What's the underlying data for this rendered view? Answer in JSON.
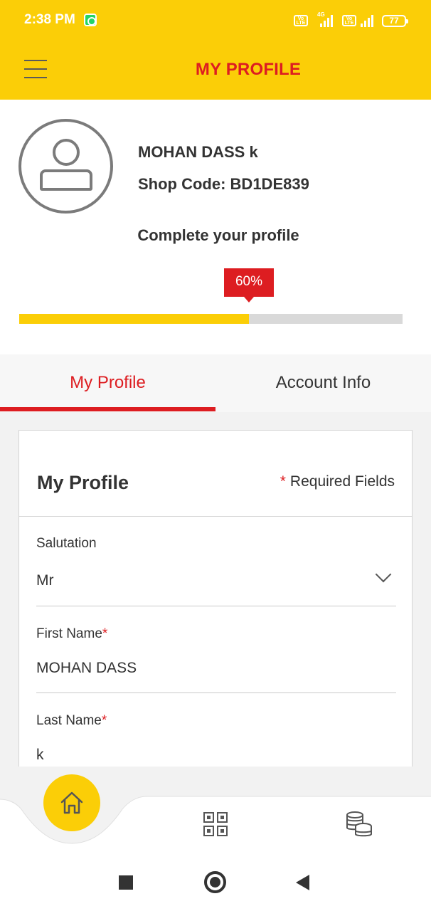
{
  "status_bar": {
    "time": "2:38 PM",
    "network": "4G",
    "battery": "77"
  },
  "header": {
    "title": "MY PROFILE"
  },
  "profile": {
    "name": "MOHAN DASS k",
    "shop_code": "Shop Code: BD1DE839",
    "complete_prompt": "Complete your profile",
    "progress_label": "60%",
    "progress_fraction": 0.6
  },
  "tabs": [
    {
      "label": "My Profile",
      "active": true
    },
    {
      "label": "Account Info",
      "active": false
    }
  ],
  "form": {
    "title": "My Profile",
    "required_star": "*",
    "required_note": "Required Fields",
    "fields": [
      {
        "label": "Salutation",
        "required": false,
        "value": "Mr",
        "type": "select"
      },
      {
        "label": "First Name",
        "required": true,
        "value": "MOHAN DASS",
        "type": "text"
      },
      {
        "label": "Last Name",
        "required": true,
        "value": "k",
        "type": "text"
      }
    ]
  },
  "colors": {
    "brand_yellow": "#fbce07",
    "brand_red": "#dd1d21",
    "text_dark": "#333333"
  },
  "icons": {
    "menu": "hamburger-icon",
    "avatar": "user-avatar-icon",
    "home": "home-icon",
    "qr": "qr-code-icon",
    "coins": "coins-icon"
  }
}
